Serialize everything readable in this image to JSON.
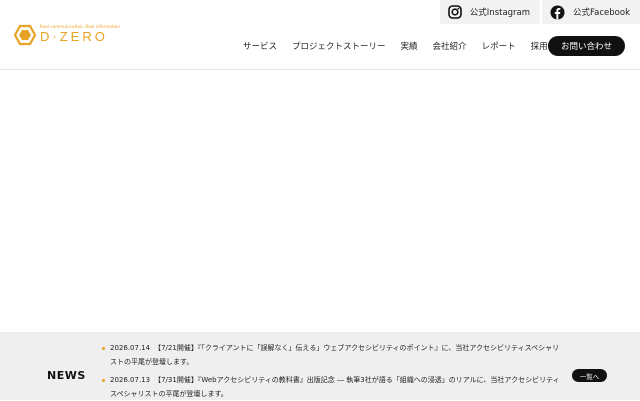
{
  "brand": {
    "tagline": "Real communication, Real information",
    "wordmark": "D·ZERO",
    "color": "#e8a324",
    "icon": "hexagon-logo-icon"
  },
  "social": [
    {
      "label": "公式Instagram",
      "icon": "instagram-icon"
    },
    {
      "label": "公式Facebook",
      "icon": "facebook-icon"
    }
  ],
  "nav": {
    "items": [
      "サービス",
      "プロジェクトストーリー",
      "実績",
      "会社紹介",
      "レポート",
      "採用情報"
    ],
    "contact_label": "お問い合わせ"
  },
  "news": {
    "title": "NEWS",
    "more_label": "一覧へ",
    "items": [
      {
        "date": "2026.07.14",
        "text": "【7/21開催】『「クライアントに「誤解なく」伝える」ウェブアクセシビリティのポイント』に、当社アクセシビリティスペシャリストの平尾が登壇します。"
      },
      {
        "date": "2026.07.13",
        "text": "【7/31開催】『Webアクセシビリティの教科書』出版記念 ― 執筆3社が語る「組織への浸透」のリアルに、当社アクセシビリティスペシャリストの平尾が登壇します。"
      }
    ]
  }
}
